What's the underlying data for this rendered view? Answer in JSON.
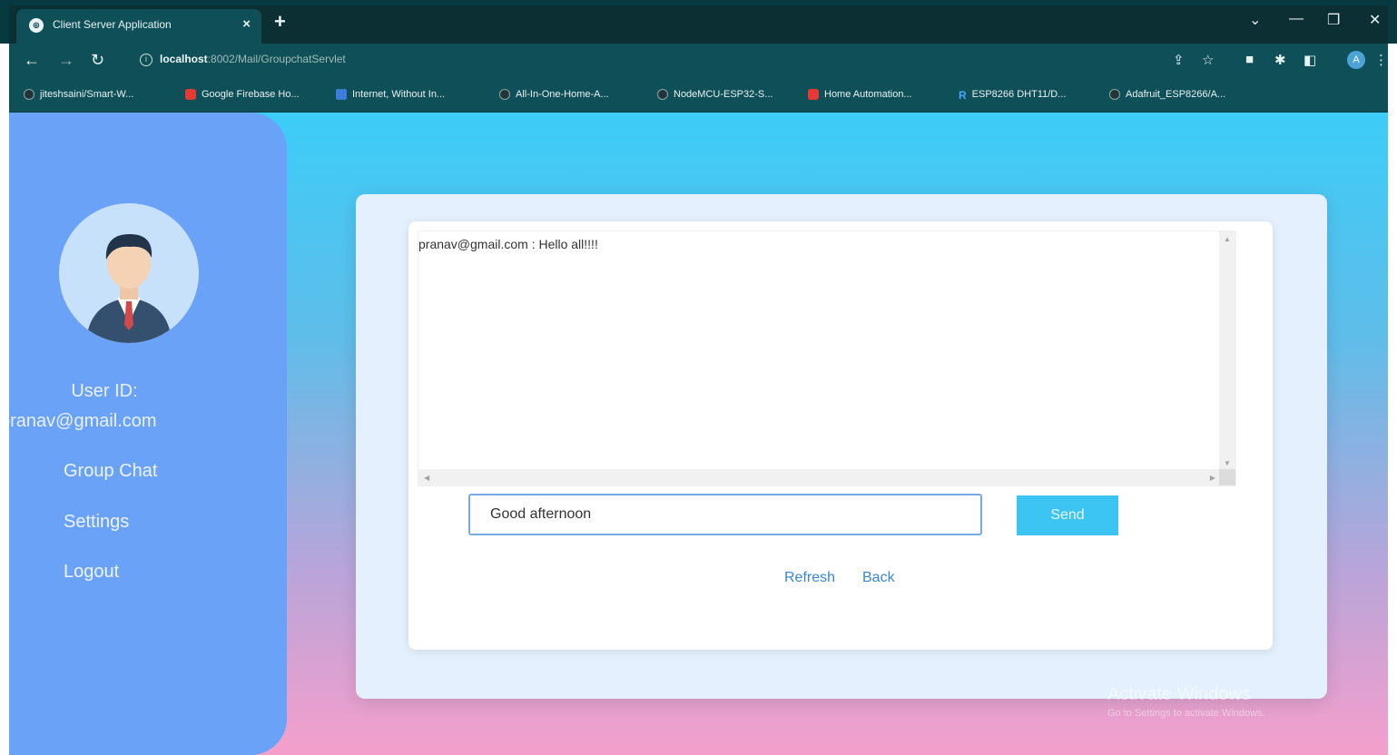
{
  "browser": {
    "tab_title": "Client Server Application",
    "tab_close": "×",
    "new_tab": "+",
    "url_host": "localhost",
    "url_rest": ":8002/Mail/GroupchatServlet",
    "profile_initial": "A",
    "bookmarks": [
      "jiteshsaini/Smart-W...",
      "Google Firebase Ho...",
      "Internet, Without In...",
      "All-In-One-Home-A...",
      "NodeMCU-ESP32-S...",
      "Home Automation...",
      "ESP8266 DHT11/D...",
      "Adafruit_ESP8266/A..."
    ]
  },
  "sidebar": {
    "user_id_label": "User ID:",
    "user_id_value": "pranav@gmail.com",
    "menu": [
      "Group Chat",
      "Settings",
      "Logout"
    ]
  },
  "chat": {
    "messages": [
      "pranav@gmail.com : Hello all!!!!"
    ],
    "input_value": "Good afternoon",
    "send_label": "Send",
    "refresh_label": "Refresh",
    "back_label": "Back"
  },
  "watermark": {
    "title": "Activate Windows",
    "subtitle": "Go to Settings to activate Windows."
  }
}
